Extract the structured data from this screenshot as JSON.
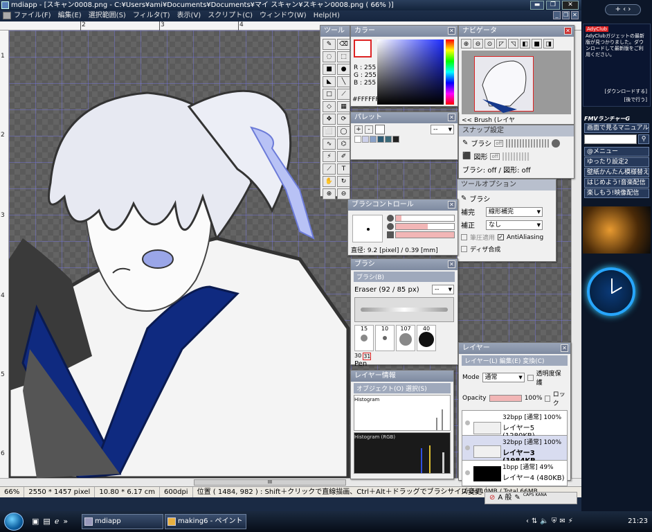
{
  "window": {
    "title": "mdiapp - [スキャン0008.png - C:¥Users¥ami¥Documents¥Documents¥マイ スキャン¥スキャン0008.png ( 66% )]"
  },
  "menu": [
    "ファイル(F)",
    "編集(E)",
    "選択範囲(S)",
    "フィルタ(T)",
    "表示(V)",
    "スクリプト(C)",
    "ウィンドウ(W)",
    "Help(H)"
  ],
  "ruler": {
    "h": [
      "2",
      "3",
      "4"
    ],
    "v": [
      "1",
      "2",
      "3",
      "4",
      "5",
      "6"
    ]
  },
  "panels": {
    "tool": {
      "title": "ツール"
    },
    "color": {
      "title": "カラー",
      "r": "R : 255",
      "g": "G : 255",
      "b": "B : 255",
      "hex": "#FFFFFF"
    },
    "navigator": {
      "title": "ナビゲータ",
      "caption": "<< Brush (レイヤ"
    },
    "palette": {
      "title": "パレット",
      "swatches": [
        "#ffffff",
        "#ccd0ea",
        "#8aa2c8",
        "#2c5a74",
        "#3a6878",
        "#222222"
      ]
    },
    "snap": {
      "title": "スナップ設定",
      "brush": "ブラシ",
      "shape": "図形",
      "off": "off",
      "status": "ブラシ: off / 図形: off"
    },
    "tool_option": {
      "title": "ツールオプション",
      "brush": "ブラシ",
      "hokan_label": "補完",
      "hokan": "線形補完",
      "hosei_label": "補正",
      "hosei": "なし",
      "pressure": "筆圧適用",
      "antialiasing": "AntiAliasing",
      "dither": "ディザ合成"
    },
    "brush_control": {
      "title": "ブラシコントロール",
      "size_fill": 0.1,
      "opacity_fill": 0.55,
      "size": "直径: 9.2 [pixel] / 0.39 [mm]"
    },
    "brush": {
      "title": "ブラシ",
      "subtitle": "ブラシ(B)",
      "current": "Eraser (92 / 85 px)",
      "preset_select": "--",
      "sizes": [
        "15",
        "10",
        "107",
        "40",
        "30",
        "31"
      ],
      "name": "Pen"
    },
    "layer_info": {
      "title": "レイヤー情報",
      "menu": "オブジェクト(O)   選択(S)",
      "histogram": "Histogram",
      "histogram_rgb": "Histogram (RGB)"
    },
    "layer": {
      "title": "レイヤー",
      "menu": "レイヤー(L)   編集(E)   変換(C)",
      "mode_label": "Mode",
      "mode": "通常",
      "protect": "透明度保護",
      "opacity_label": "Opacity",
      "opacity": "100%",
      "lock": "ロック",
      "items": [
        {
          "meta": "32bpp [通常] 100%",
          "name": "レイヤー5 (1280KB)"
        },
        {
          "meta": "32bpp [通常] 100%",
          "name": "レイヤー3 (1984KB"
        },
        {
          "meta": "1bpp [通常] 49%",
          "name": "レイヤー4 (480KB)"
        }
      ],
      "undo": "Undo 10MB / Total 66MB"
    }
  },
  "status": [
    "66%",
    "2550 * 1457 pixel",
    "10.80 * 6.17 cm",
    "600dpi",
    "位置 ( 1484, 982 ) : Shift＋クリックで直線描画、Ctrl＋Alt＋ドラッグでブラシサイズ変更"
  ],
  "sidebar": {
    "ad_title": "AdyClub",
    "ad_text": "AdyClubガジェットの最新版が見つかりました。ダウンロードして最新版をご利用ください。",
    "ad_link": "[ダウンロードする]",
    "ad_later": "[後で行う]",
    "launcher": "FMVランチャーG",
    "links": [
      "画面で見るマニュアル",
      "@メニュー",
      "ゆったり設定2",
      "壁紙かんたん模様替え",
      "はじめよう!音楽配信",
      "楽しもう!映像配信"
    ]
  },
  "taskbar": {
    "items": [
      "mdiapp",
      "making6 - ペイント"
    ],
    "ime": "A 般",
    "caps": "CAPS KANA",
    "time": "21:23"
  }
}
